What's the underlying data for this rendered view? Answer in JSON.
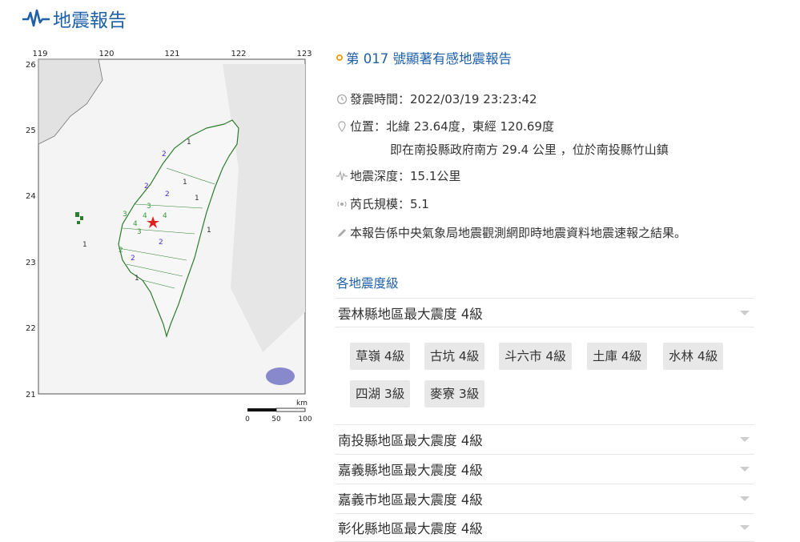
{
  "header": {
    "title": "地震報告",
    "icon": "seismograph-icon"
  },
  "map": {
    "lon_ticks": [
      "119",
      "120",
      "121",
      "122",
      "123"
    ],
    "lat_ticks": [
      "26",
      "25",
      "24",
      "23",
      "22",
      "21"
    ],
    "scale_unit": "km",
    "scale_labels": [
      "0",
      "50",
      "100"
    ],
    "intensity_labels": [
      "1",
      "2",
      "3",
      "4"
    ],
    "colors": {
      "i1": "#333333",
      "i2": "#4a2fd0",
      "i3": "#3a9a3a",
      "i4": "#3a9a3a",
      "epicenter": "#e02020"
    }
  },
  "report": {
    "heading": "第 017 號顯著有感地震報告",
    "time": "發震時間：2022/03/19 23:23:42",
    "location": "位置：北緯 23.64度，東經 120.69度",
    "location_detail": "即在南投縣政府南方 29.4 公里 ，位於南投縣竹山鎮",
    "depth": "地震深度：15.1公里",
    "magnitude": "芮氏規模：5.1",
    "note": "本報告係中央氣象局地震觀測網即時地震資料地震速報之結果。"
  },
  "intensity_section": {
    "title": "各地震度級",
    "regions": [
      {
        "label": "雲林縣地區最大震度 4級",
        "expanded": true,
        "stations": [
          "草嶺 4級",
          "古坑 4級",
          "斗六市 4級",
          "土庫 4級",
          "水林 4級",
          "四湖 3級",
          "麥寮 3級"
        ]
      },
      {
        "label": "南投縣地區最大震度 4級",
        "expanded": false
      },
      {
        "label": "嘉義縣地區最大震度 4級",
        "expanded": false
      },
      {
        "label": "嘉義市地區最大震度 4級",
        "expanded": false
      },
      {
        "label": "彰化縣地區最大震度 4級",
        "expanded": false
      }
    ]
  }
}
